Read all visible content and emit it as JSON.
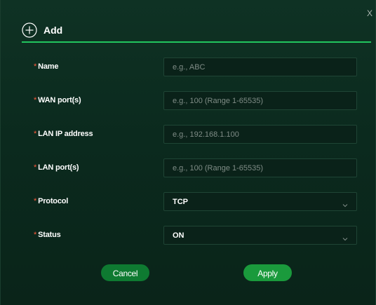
{
  "dialog": {
    "title": "Add",
    "close_label": "X"
  },
  "form": {
    "required_mark": "*",
    "fields": [
      {
        "label": "Name",
        "placeholder": "e.g., ABC",
        "value": ""
      },
      {
        "label": "WAN port(s)",
        "placeholder": "e.g., 100 (Range 1-65535)",
        "value": ""
      },
      {
        "label": "LAN IP address",
        "placeholder": "e.g., 192.168.1.100",
        "value": ""
      },
      {
        "label": "LAN port(s)",
        "placeholder": "e.g., 100 (Range 1-65535)",
        "value": ""
      }
    ],
    "protocol": {
      "label": "Protocol",
      "value": "TCP"
    },
    "status": {
      "label": "Status",
      "value": "ON"
    }
  },
  "actions": {
    "cancel_label": "Cancel",
    "apply_label": "Apply"
  },
  "colors": {
    "accent": "#22c55e",
    "button": "#0e7a31",
    "required": "#ff5a3c",
    "background": "#0b2a1e"
  },
  "icons": {
    "add": "plus-circle-icon",
    "dropdown": "chevron-down-icon",
    "close": "close-icon"
  }
}
